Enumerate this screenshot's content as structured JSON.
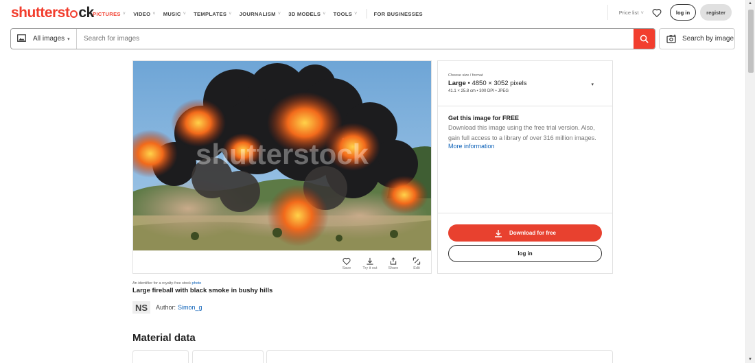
{
  "logo": {
    "text_main": "shutterst",
    "text_mid": "ck",
    "o_char": "○"
  },
  "nav": {
    "items": [
      {
        "label": "PICTURES",
        "active": true
      },
      {
        "label": "VIDEO"
      },
      {
        "label": "MUSIC"
      },
      {
        "label": "TEMPLATES"
      },
      {
        "label": "JOURNALISM"
      },
      {
        "label": "3D MODELS"
      },
      {
        "label": "TOOLS"
      }
    ],
    "business": "FOR BUSINESSES",
    "price_list": "Price list",
    "login": "log in",
    "register": "register"
  },
  "search": {
    "scope": "All images",
    "placeholder": "Search for images",
    "by_image": "Search by image"
  },
  "image": {
    "watermark": "shutterstock",
    "tools": [
      "Save",
      "Try it out",
      "Share",
      "Edit"
    ],
    "caption_prefix": "An identifier for a royalty-free stock",
    "caption_type": "photo",
    "title": "Large fireball with black smoke in bushy hills",
    "author_initials": "NS",
    "author_label": "Author:",
    "author_name": "Simon_g"
  },
  "panel": {
    "size_hint": "Choose size / format",
    "size_name": "Large",
    "size_dims": " • 4850 × 3052 pixels",
    "size_sub": "41.1 × 25.8 cm • 300 DPI • JPEG",
    "free_title": "Get this image for FREE",
    "free_desc": "Download this image using the free trial version. Also, gain full access to a library of over 316 million images.",
    "more_info": "More information",
    "download": "Download for free",
    "login": "log in"
  },
  "section": {
    "material_data": "Material data"
  },
  "colors": {
    "brand": "#f23e2e",
    "link": "#0c61b8"
  }
}
